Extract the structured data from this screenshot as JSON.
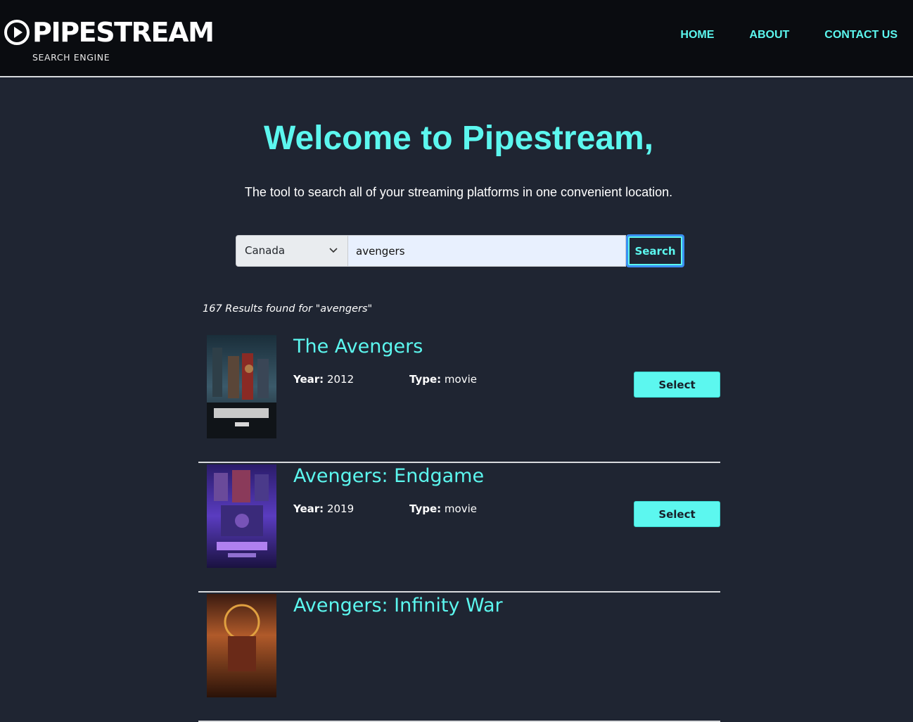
{
  "header": {
    "logo_text": "PIPESTREAM",
    "logo_subtitle": "SEARCH ENGINE",
    "nav": [
      {
        "label": "HOME"
      },
      {
        "label": "ABOUT"
      },
      {
        "label": "CONTACT US"
      }
    ]
  },
  "hero": {
    "title": "Welcome to Pipestream,",
    "subtitle": "The tool to search all of your streaming platforms in one convenient location."
  },
  "search": {
    "country_selected": "Canada",
    "query_value": "avengers",
    "button_label": "Search"
  },
  "results": {
    "summary": "167 Results found for \"avengers\"",
    "year_label": "Year:",
    "type_label": "Type:",
    "select_label": "Select",
    "items": [
      {
        "title": "The Avengers",
        "year": "2012",
        "type": "movie",
        "poster_icon": "avengers-poster",
        "poster_color": "#2c4a5c"
      },
      {
        "title": "Avengers: Endgame",
        "year": "2019",
        "type": "movie",
        "poster_icon": "endgame-poster",
        "poster_color": "#3a2a8c"
      },
      {
        "title": "Avengers: Infinity War",
        "year": "",
        "type": "",
        "poster_icon": "infinity-war-poster",
        "poster_color": "#8a3a1a"
      }
    ]
  },
  "colors": {
    "accent": "#5cf7ef",
    "background": "#1f2532",
    "header_bg": "#0a0c10"
  }
}
